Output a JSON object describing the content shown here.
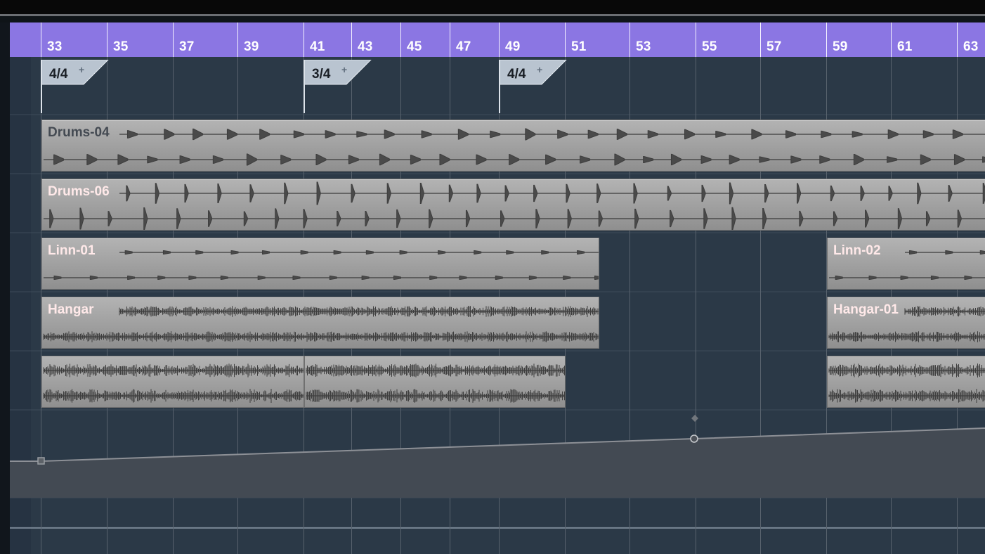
{
  "ruler": {
    "bars": [
      "33",
      "35",
      "37",
      "39",
      "41",
      "43",
      "45",
      "47",
      "49",
      "51",
      "53",
      "55",
      "57",
      "59",
      "61",
      "63"
    ]
  },
  "signature_track": {
    "markers": [
      {
        "label": "4/4",
        "plus": "+"
      },
      {
        "label": "3/4",
        "plus": "+"
      },
      {
        "label": "4/4",
        "plus": "+"
      }
    ]
  },
  "audio_events": [
    {
      "name": "Drums-04"
    },
    {
      "name": "Drums-06"
    },
    {
      "name": "Linn-01"
    },
    {
      "name": "Linn-02"
    },
    {
      "name": "Hangar"
    },
    {
      "name": "Hangar-01"
    },
    {
      "name": ""
    },
    {
      "name": ""
    },
    {
      "name": ""
    }
  ],
  "colors": {
    "ruler": "#8b76e3",
    "track_background": "#2b3947",
    "event_fill": "#a3a3a3",
    "event_label": "#ffe9e9",
    "automation_line": "#8d9096"
  },
  "icons": [
    "automation-node-icon",
    "automation-diamond-icon",
    "automation-square-node-icon"
  ]
}
